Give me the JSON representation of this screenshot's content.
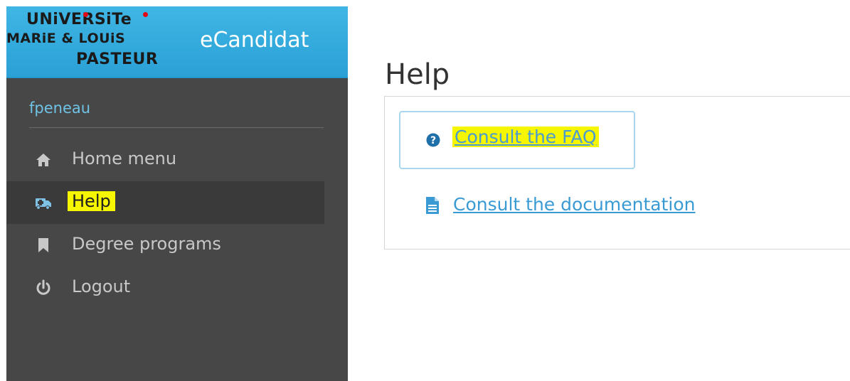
{
  "brand": {
    "logo_text": [
      "UNiVERSiTe",
      "MARiE & LOUiS",
      "PASTEUR"
    ],
    "app_name": "eCandidat"
  },
  "user": {
    "name": "fpeneau"
  },
  "nav": {
    "items": [
      {
        "label": "Home menu",
        "icon": "home-icon",
        "active": false
      },
      {
        "label": "Help",
        "icon": "ambulance-icon",
        "active": true
      },
      {
        "label": "Degree programs",
        "icon": "bookmark-icon",
        "active": false
      },
      {
        "label": "Logout",
        "icon": "power-icon",
        "active": false
      }
    ]
  },
  "main": {
    "title": "Help",
    "links": [
      {
        "label": "Consult the FAQ",
        "icon": "question-circle-icon"
      },
      {
        "label": "Consult the documentation",
        "icon": "document-icon"
      }
    ]
  },
  "colors": {
    "sidebar_bg": "#474747",
    "brand_bg": "#3fb6e4",
    "link": "#3a9bd4",
    "highlight": "#f6f600"
  }
}
